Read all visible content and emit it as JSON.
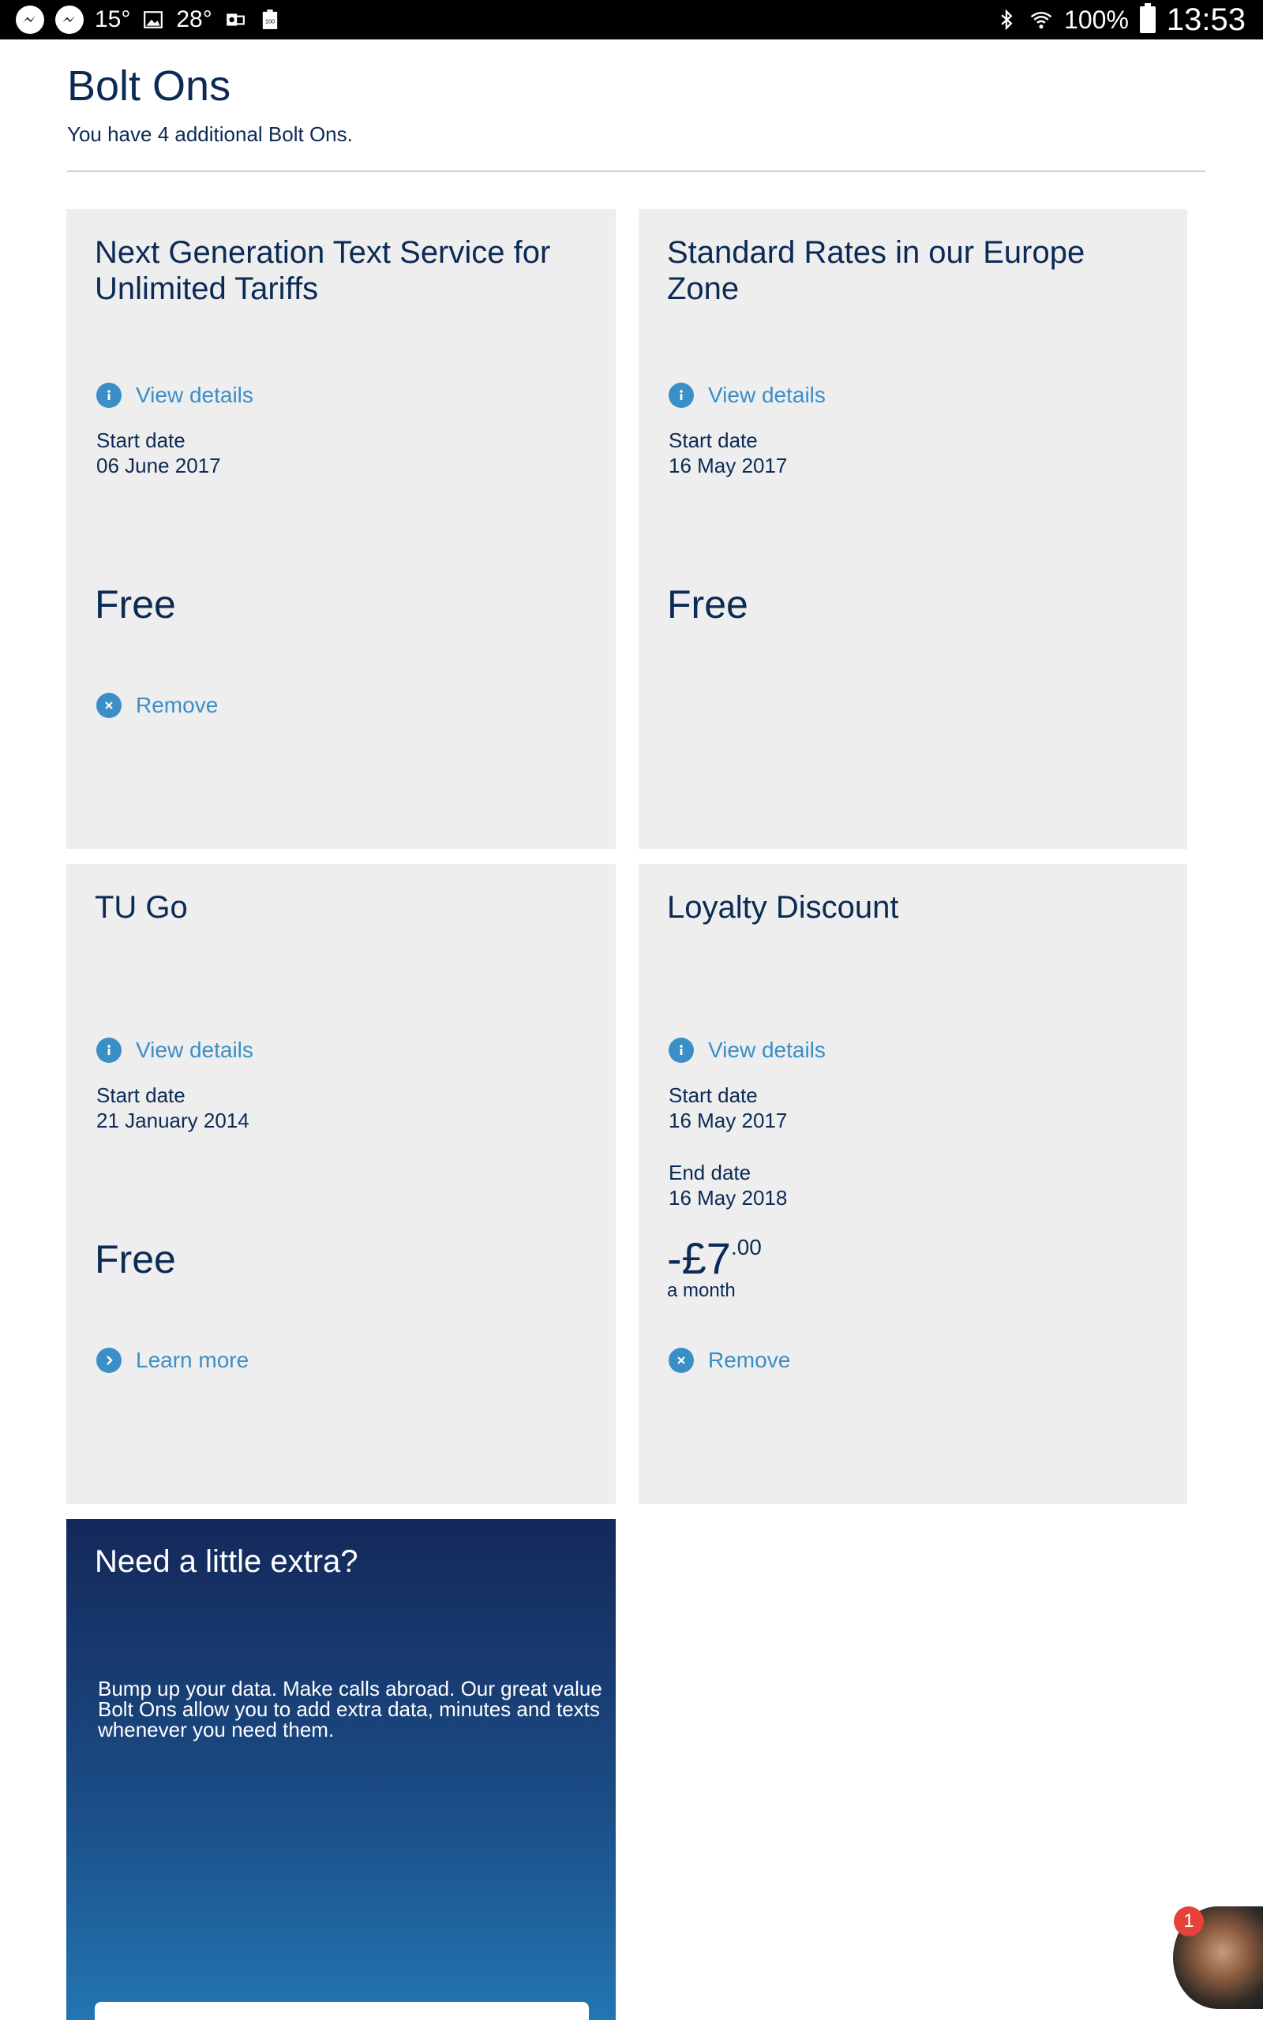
{
  "status_bar": {
    "temp1": "15°",
    "temp2": "28°",
    "battery_badge": "100",
    "battery_percent": "100%",
    "time": "13:53"
  },
  "page": {
    "title": "Bolt Ons",
    "subtitle": "You have 4 additional Bolt Ons."
  },
  "cards": [
    {
      "title": "Next Generation Text Service for Unlimited Tariffs",
      "details_label": "View details",
      "start_label": "Start date",
      "start_value": "06 June 2017",
      "price": "Free",
      "action_label": "Remove"
    },
    {
      "title": "Standard Rates in our Europe Zone",
      "details_label": "View details",
      "start_label": "Start date",
      "start_value": "16 May 2017",
      "price": "Free"
    },
    {
      "title": "TU Go",
      "details_label": "View details",
      "start_label": "Start date",
      "start_value": "21 January 2014",
      "price": "Free",
      "action_label": "Learn more"
    },
    {
      "title": "Loyalty Discount",
      "details_label": "View details",
      "start_label": "Start date",
      "start_value": "16 May 2017",
      "end_label": "End date",
      "end_value": "16 May 2018",
      "price_main": "-£7",
      "price_pence": ".00",
      "price_period": "a month",
      "action_label": "Remove"
    }
  ],
  "promo": {
    "title": "Need a little extra?",
    "text": "Bump up your data. Make calls abroad. Our great value Bolt Ons allow you to add extra data, minutes and texts whenever you need them."
  },
  "chat": {
    "badge_count": "1"
  },
  "colors": {
    "navy": "#0b2a55",
    "link_blue": "#3a8fc7",
    "card_bg": "#eeeeee",
    "badge_red": "#e8403b"
  }
}
